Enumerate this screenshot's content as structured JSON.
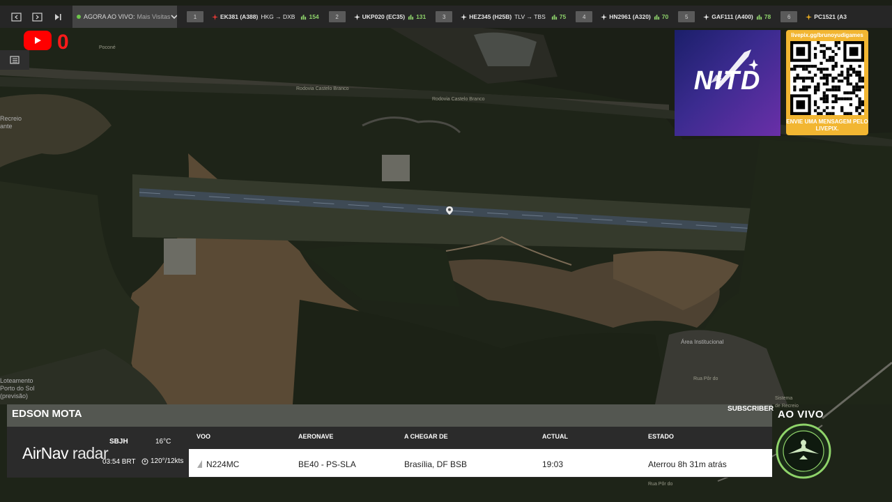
{
  "topbar": {
    "live_label": "AGORA AO VIVO:",
    "live_sub": "Mais Visitas",
    "flights": [
      {
        "rank": "1",
        "callsign": "EK381 (A388)",
        "route": "HKG → DXB",
        "viewers": "154",
        "plane_color": "#e53935"
      },
      {
        "rank": "2",
        "callsign": "UKP020 (EC35)",
        "route": "",
        "viewers": "131",
        "plane_color": "#f0f0f0"
      },
      {
        "rank": "3",
        "callsign": "HEZ345 (H25B)",
        "route": "TLV → TBS",
        "viewers": "75",
        "plane_color": "#f0f0f0"
      },
      {
        "rank": "4",
        "callsign": "HN2961 (A320)",
        "route": "",
        "viewers": "70",
        "plane_color": "#f0f0f0"
      },
      {
        "rank": "5",
        "callsign": "GAF111 (A400)",
        "route": "",
        "viewers": "78",
        "plane_color": "#f0f0f0"
      },
      {
        "rank": "6",
        "callsign": "PC1521 (A3",
        "route": "",
        "viewers": "",
        "plane_color": "#f0b020"
      }
    ]
  },
  "youtube": {
    "count": "0"
  },
  "map": {
    "labels": [
      {
        "text": "Poconé"
      },
      {
        "text": "Rodovia Castelo Branco"
      },
      {
        "text": "Rodovia Castelo Branco"
      },
      {
        "text": "Recreio\nante"
      },
      {
        "text": "Área Institucional"
      },
      {
        "text": "Loteamento\nPorto do Sol\n(previsão)"
      },
      {
        "text": "Sistema\nde Recreio"
      },
      {
        "text": "Rua Pôr do"
      },
      {
        "text": "Rua Pôr do"
      }
    ]
  },
  "sponsor": {
    "nitd_text": "NITD",
    "qr_url": "livepix.gg/brunoyudigames",
    "qr_msg": "ENVIE UMA MENSAGEM PELO LIVEPIX."
  },
  "lower": {
    "name": "EDSON MOTA",
    "subscriber": "SUBSCRIBER",
    "live": "AO VIVO",
    "brand_main": "AirNav",
    "brand_sub": "radar",
    "airport": "SBJH",
    "local_time": "03:54 BRT",
    "temperature": "16°C",
    "wind": "120°/12kts"
  },
  "flight_table": {
    "headers": {
      "flight": "VOO",
      "aircraft": "AERONAVE",
      "from": "A CHEGAR DE",
      "actual": "ACTUAL",
      "status": "ESTADO"
    },
    "row": {
      "flight": "N224MC",
      "aircraft": "BE40 - PS-SLA",
      "from": "Brasília, DF BSB",
      "actual": "19:03",
      "status": "Aterrou 8h 31m atrás"
    }
  },
  "colors": {
    "accent_green": "#8ed36b",
    "youtube_red": "#ff0000",
    "livepix_gold": "#f2b632"
  }
}
